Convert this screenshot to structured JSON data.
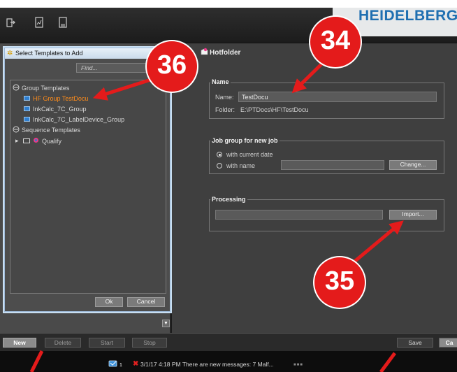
{
  "brand": {
    "logo": "HEIDELBERG",
    "logo_color": "#1f6fb1"
  },
  "toolbar": {
    "icons": [
      "exit-icon",
      "chart-icon",
      "report-icon"
    ]
  },
  "hotfolder": {
    "title": "Hotfolder",
    "name_group": {
      "label": "Name",
      "name_label": "Name:",
      "name_value": "TestDocu",
      "folder_label": "Folder:",
      "folder_value": "E:\\PTDocs\\HF\\TestDocu"
    },
    "job_group": {
      "label": "Job group for new job",
      "option_date": "with current date",
      "option_name": "with name",
      "change_button": "Change...",
      "selected": "with current date"
    },
    "processing": {
      "label": "Processing",
      "import_button": "Import..."
    }
  },
  "dialog": {
    "title": "Select Templates to Add",
    "find_placeholder": "Find...",
    "tree": {
      "group_header": "Group Templates",
      "group_items": [
        "HF Group TestDocu",
        "InkCalc_7C_Group",
        "InkCalc_7C_LabelDevice_Group"
      ],
      "selected_item": "HF Group TestDocu",
      "sequence_header": "Sequence Templates",
      "sequence_items": [
        "Qualify"
      ]
    },
    "ok_button": "Ok",
    "cancel_button": "Cancel"
  },
  "bottom_bar": {
    "new": "New",
    "delete": "Delete",
    "start": "Start",
    "stop": "Stop",
    "save": "Save",
    "cancel": "Ca"
  },
  "status_bar": {
    "count": "1",
    "message": "3/1/17 4:18 PM  There are new messages: 7 Malf..."
  },
  "callouts": {
    "c34": "34",
    "c35": "35",
    "c36": "36"
  },
  "colors": {
    "callout": "#e41b1b",
    "selected_item": "#ff8c1a",
    "panel": "#3f3f3f"
  }
}
